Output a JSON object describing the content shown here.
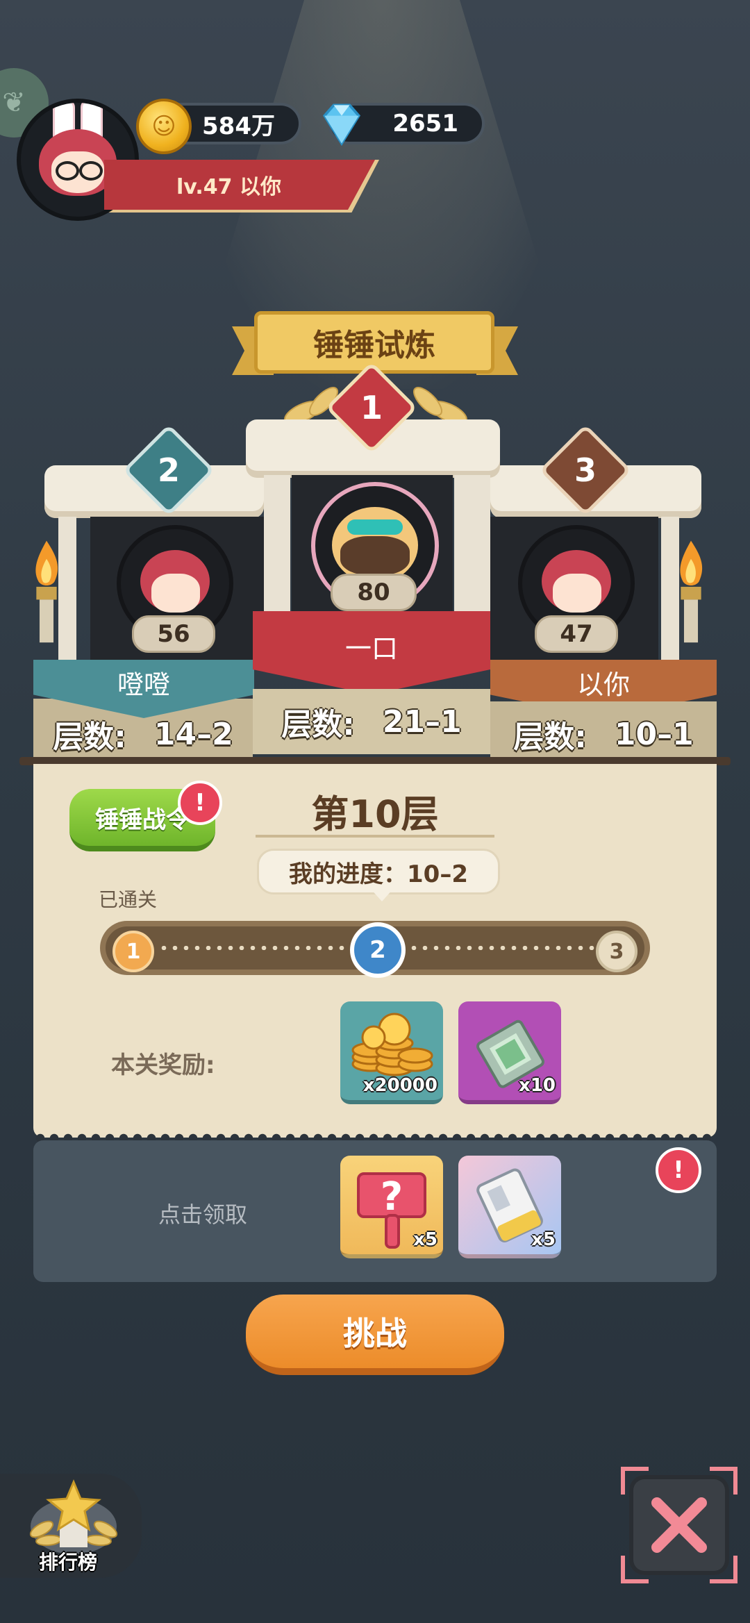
{
  "currency": {
    "coins": "584万",
    "gems": "2651"
  },
  "player": {
    "level_text": "lv.47 以你"
  },
  "event": {
    "title": "锤锤试炼"
  },
  "podium": [
    {
      "rank": "2",
      "score": "56",
      "name": "噔噔",
      "floor_label": "层数:",
      "floor_value": "14–2",
      "color": "#4c8f96"
    },
    {
      "rank": "1",
      "score": "80",
      "name": "一口",
      "floor_label": "层数:",
      "floor_value": "21–1",
      "color": "#c33a42"
    },
    {
      "rank": "3",
      "score": "47",
      "name": "以你",
      "floor_label": "层数:",
      "floor_value": "10–1",
      "color": "#b96a3c"
    }
  ],
  "stage": {
    "hammer_button": "锤锤战令",
    "alert_mark": "!",
    "floor_title": "第10层",
    "my_progress": "我的进度：10–2",
    "passed_label": "已通关",
    "nodes": [
      "1",
      "2",
      "3"
    ],
    "current_node": 2
  },
  "rewards": {
    "label": "本关奖励:",
    "items": [
      {
        "icon": "coin-stack-icon",
        "count": "x20000"
      },
      {
        "icon": "scroll-ticket-icon",
        "count": "x10"
      }
    ]
  },
  "claim": {
    "label": "点击领取",
    "items": [
      {
        "icon": "mystery-hammer-icon",
        "count": "x5"
      },
      {
        "icon": "ticket-card-icon",
        "count": "x5"
      }
    ]
  },
  "actions": {
    "challenge": "挑战",
    "leaderboard": "排行榜"
  }
}
